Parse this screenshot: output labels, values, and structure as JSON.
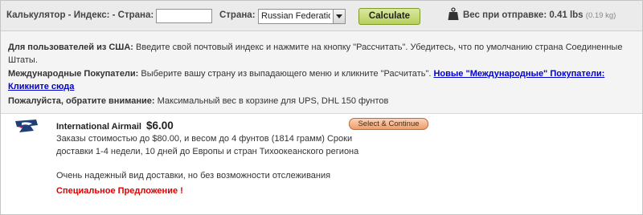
{
  "calculator": {
    "label": "Калькулятор - Индекс: - Страна:",
    "zip_value": "",
    "country_label": "Страна:",
    "country_selected": "Russian Federation",
    "calculate_label": "Calculate"
  },
  "weight": {
    "label": "Вес при отправке:",
    "value": "0.41 lbs",
    "kg": "(0.19 kg)",
    "icon": "weight-icon"
  },
  "info": {
    "us_bold": "Для пользователей из США:",
    "us_text": " Введите свой почтовый индекс и нажмите на кнопку \"Рассчитать\". Убедитесь, что по умолчанию страна Соединенные Штаты.",
    "intl_bold": "Международные Покупатели:",
    "intl_text": " Выберите вашу страну из выпадающего меню и кликните \"Расчитать\". ",
    "intl_link": "Новые \"Международные\" Покупатели: Кликните сюда",
    "note_bold": "Пожалуйста, обратите внимание:",
    "note_text": " Максимальный вес в корзине для UPS, DHL 150 фунтов"
  },
  "shipping_option": {
    "carrier_icon": "usps-eagle-icon",
    "name": "International Airmail",
    "price": "$6.00",
    "select_label": "Select & Continue",
    "description": "Заказы стоимостью до $80.00, и весом до 4 фунтов (1814 грамм) Сроки доставки 1-4 недели, 10 дней до Европы и стран Тихоокеанского региона",
    "note": "Очень надежный вид доставки, но без возможности отслеживания",
    "special": "Специальное Предложение !"
  },
  "colors": {
    "calculate_button": "#c4d86e",
    "select_continue_button": "#f2a77a",
    "link": "#0000cc",
    "special": "#e00000",
    "usps_blue": "#1f3f7a"
  }
}
